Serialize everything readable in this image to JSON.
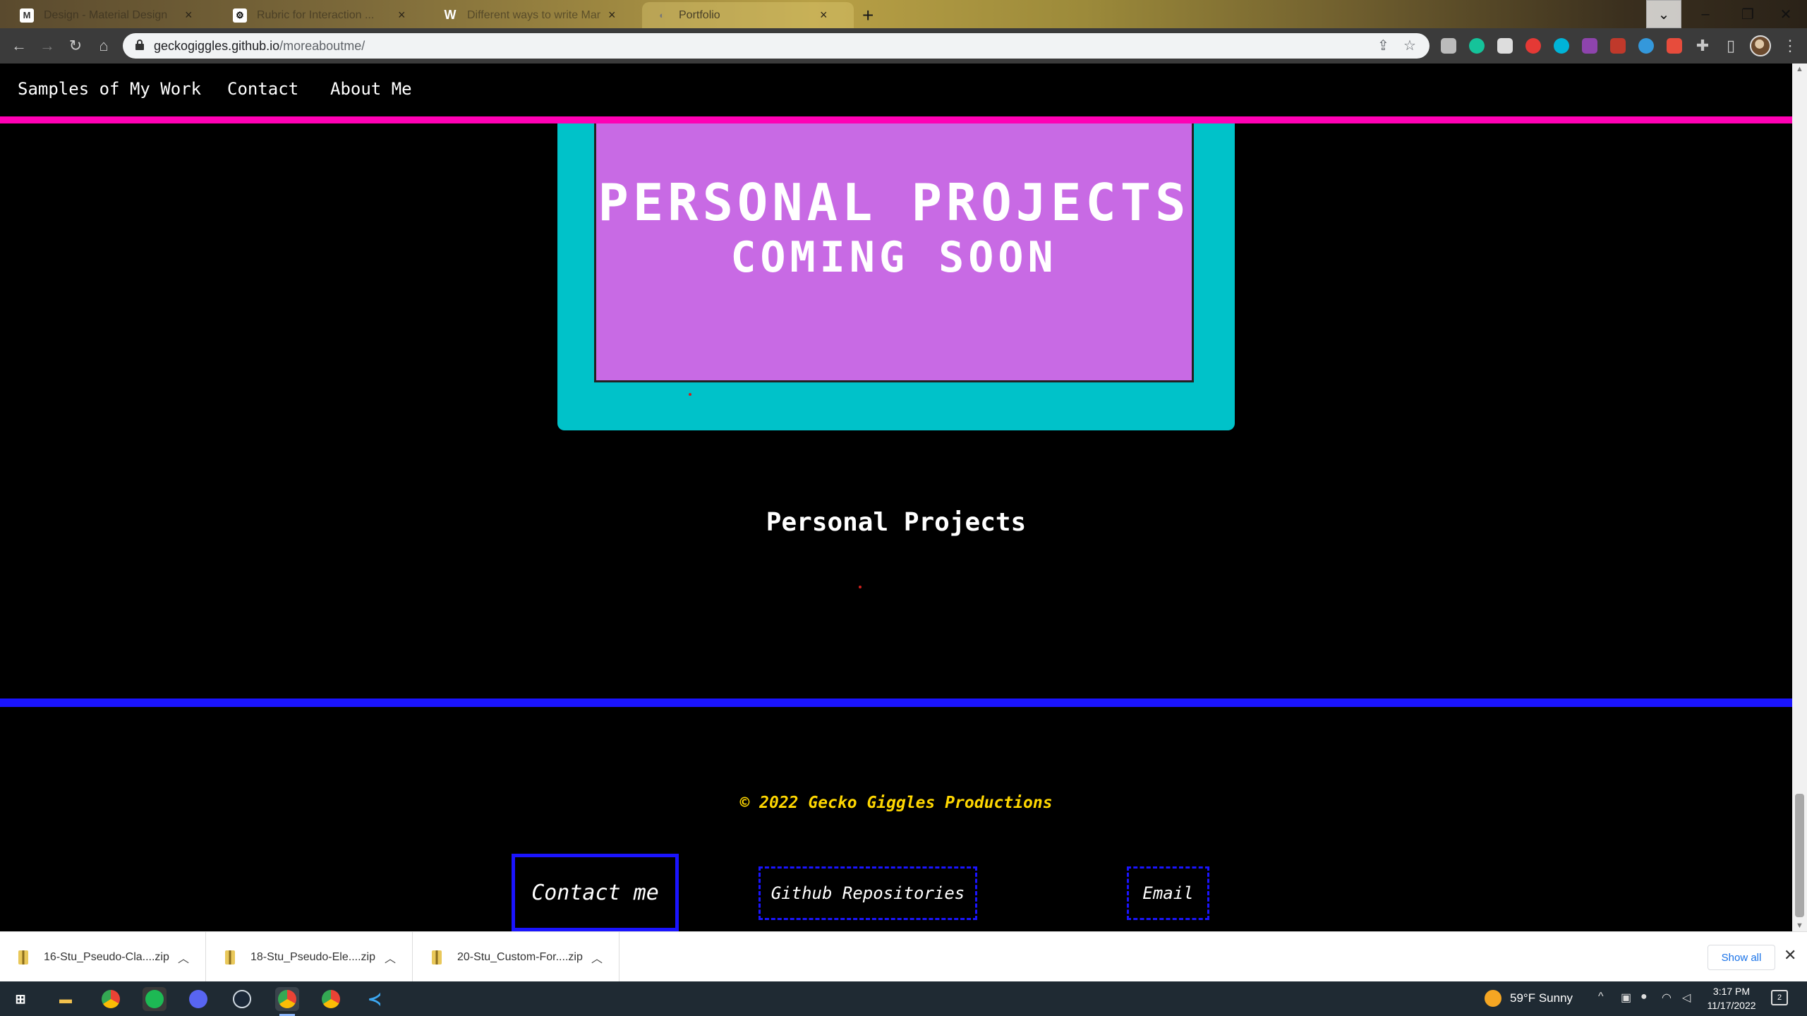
{
  "browser": {
    "tabs": [
      {
        "title": "Design - Material Design",
        "favicon": "M"
      },
      {
        "title": "Rubric for Interaction ...",
        "favicon": "⚙"
      },
      {
        "title": "Different ways to write Markdown",
        "favicon": "W"
      },
      {
        "title": "Portfolio",
        "favicon": "◐"
      }
    ],
    "url_host": "geckogiggles.github.io",
    "url_path": "/moreaboutme/"
  },
  "site": {
    "nav": [
      {
        "label": "Samples of My Work"
      },
      {
        "label": "Contact"
      },
      {
        "label": "About Me"
      }
    ],
    "screen_line1": "PERSONAL PROJECTS",
    "screen_line2": "COMING SOON",
    "section_heading": "Personal Projects",
    "copyright": "© 2022 Gecko Giggles Productions",
    "footer_buttons": {
      "contact": "Contact me",
      "github": "Github Repositories",
      "email": "Email"
    },
    "colors": {
      "accent_pink": "#ff00b4",
      "accent_blue": "#1a14ff",
      "monitor_frame": "#00c2c9",
      "screen": "#c86ae4",
      "copyright": "#ffd700"
    }
  },
  "downloads": {
    "items": [
      {
        "name": "16-Stu_Pseudo-Cla....zip"
      },
      {
        "name": "18-Stu_Pseudo-Ele....zip"
      },
      {
        "name": "20-Stu_Custom-For....zip"
      }
    ],
    "show_all": "Show all"
  },
  "taskbar": {
    "weather": "59°F  Sunny",
    "time": "3:17 PM",
    "date": "11/17/2022",
    "notifications": "2"
  }
}
